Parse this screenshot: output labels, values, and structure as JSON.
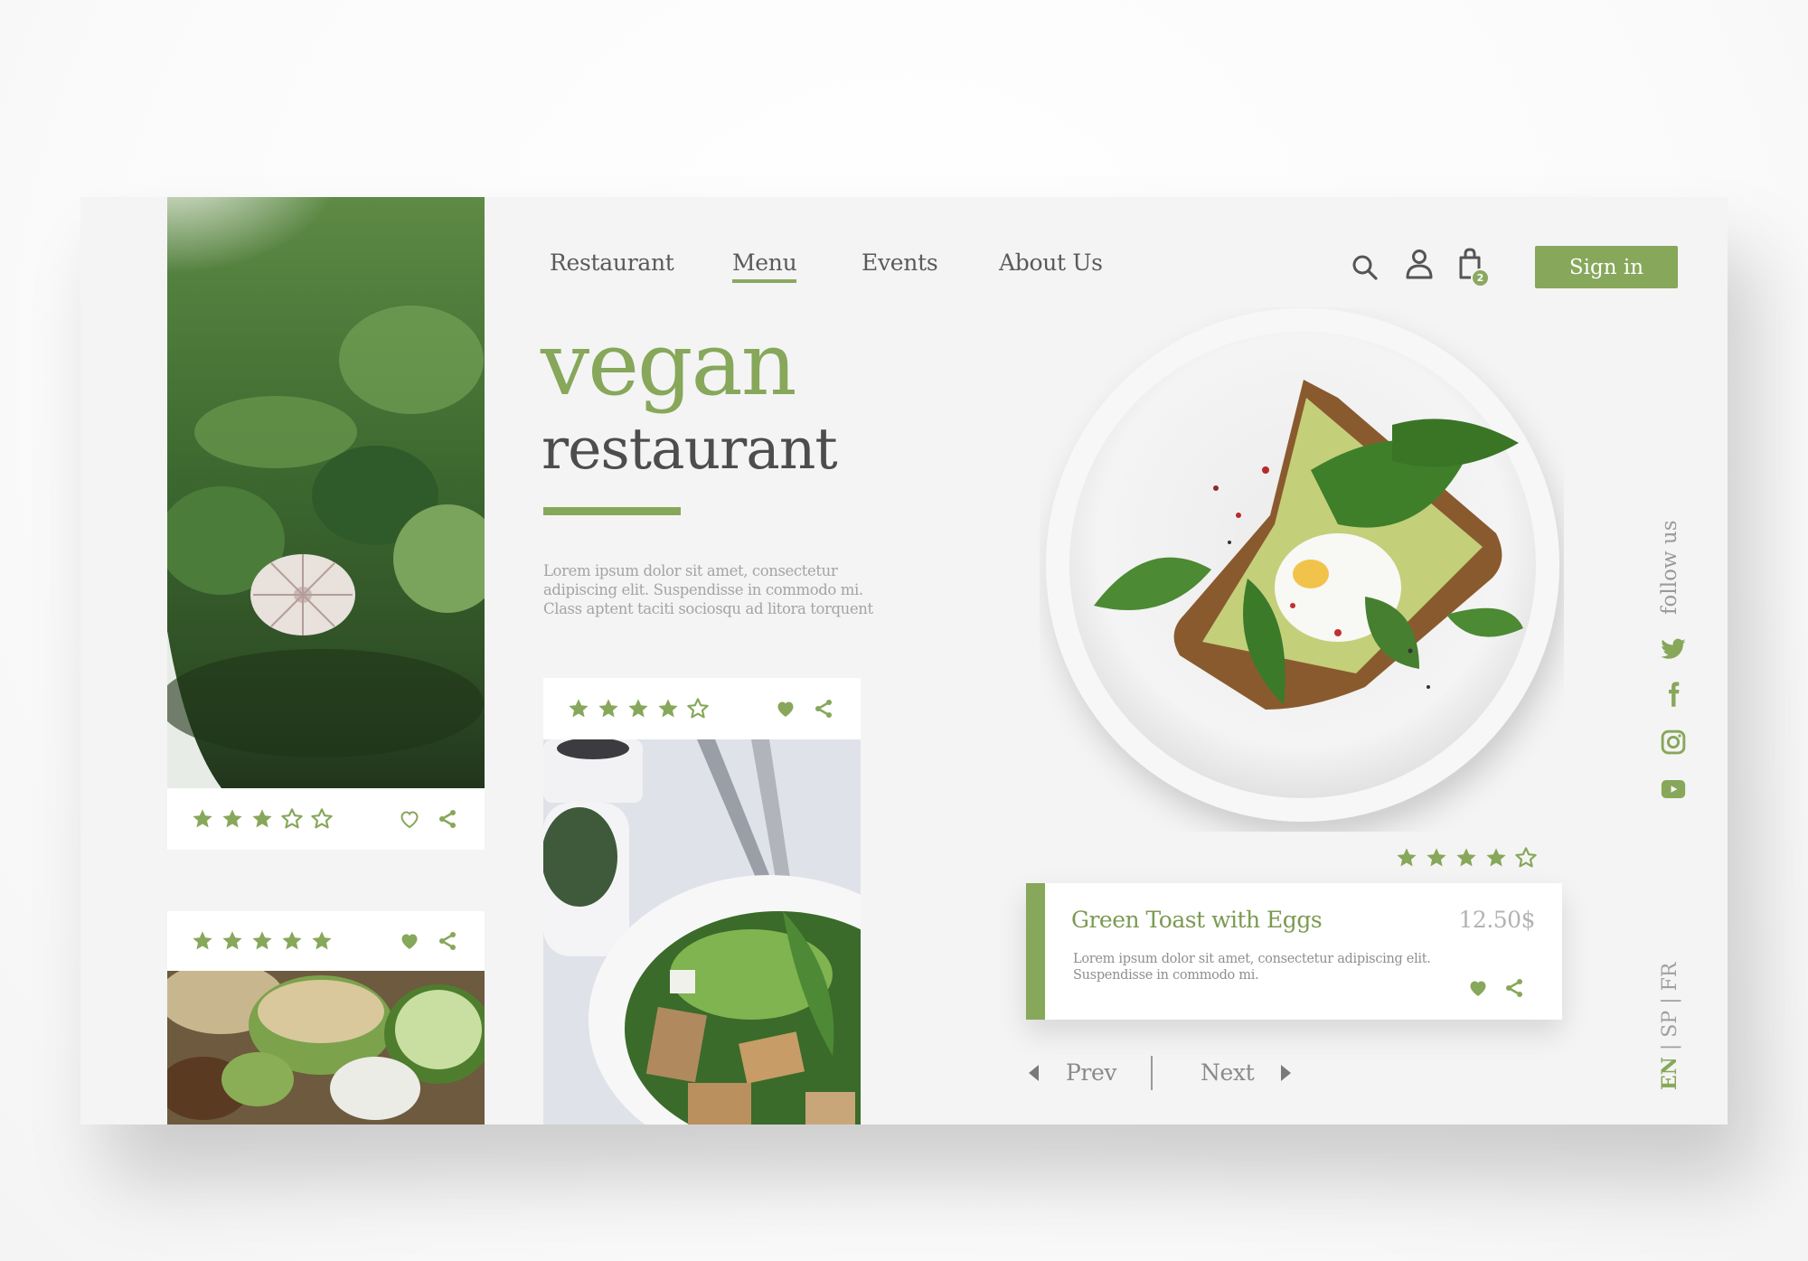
{
  "brand_colors": {
    "accent": "#87a75a",
    "text_dark": "#4d4d4d",
    "text_muted": "#a4a4a4",
    "card_bg": "#ffffff",
    "page_bg": "#f4f4f4"
  },
  "nav": {
    "items": [
      {
        "label": "Restaurant",
        "active": false
      },
      {
        "label": "Menu",
        "active": true
      },
      {
        "label": "Events",
        "active": false
      },
      {
        "label": "About Us",
        "active": false
      }
    ]
  },
  "header": {
    "icons": [
      "search-icon",
      "user-icon",
      "shopping-bag-icon"
    ],
    "cart_count": "2",
    "sign_in_label": "Sign in"
  },
  "hero": {
    "title": "vegan",
    "subtitle": "restaurant",
    "description": "Lorem ipsum dolor sit amet, consectetur adipiscing elit. Suspendisse in commodo mi. Class aptent taciti sociosqu ad litora torquent"
  },
  "cards": [
    {
      "image": "broccoli-garlic-photo",
      "rating": 3,
      "max_rating": 5,
      "liked": false
    },
    {
      "image": "cucumber-salad-photo",
      "rating": 5,
      "max_rating": 5,
      "liked": true
    },
    {
      "image": "tofu-bowl-photo",
      "rating": 4,
      "max_rating": 5,
      "liked": true
    }
  ],
  "featured": {
    "image": "avocado-toast-plate-photo",
    "rating": 4,
    "max_rating": 5,
    "name": "Green Toast with Eggs",
    "price": "12.50$",
    "description": "Lorem ipsum dolor sit amet, consectetur adipiscing elit. Suspendisse in commodo mi.",
    "liked": true
  },
  "pager": {
    "prev_label": "Prev",
    "next_label": "Next"
  },
  "social": {
    "label": "follow us",
    "icons": [
      "twitter-icon",
      "facebook-icon",
      "instagram-icon",
      "youtube-icon"
    ]
  },
  "languages": {
    "items": [
      "EN",
      "SP",
      "FR"
    ],
    "separator": "|",
    "active": "EN"
  }
}
